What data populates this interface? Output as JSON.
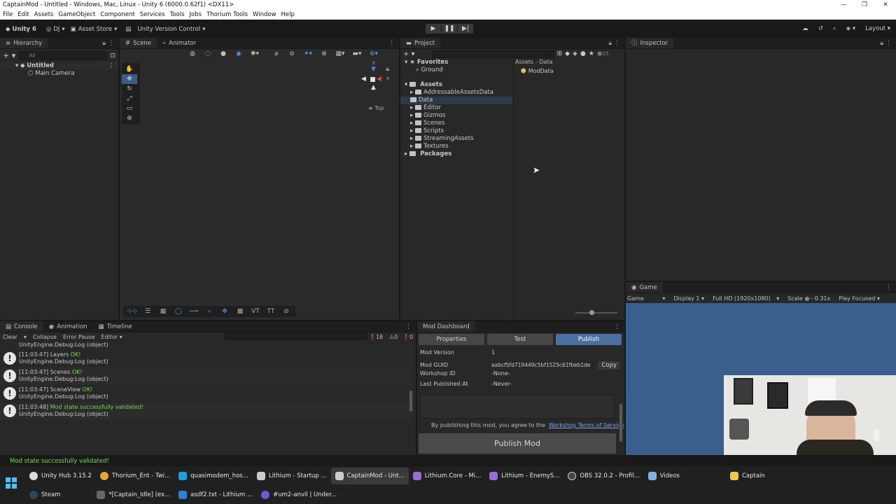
{
  "window": {
    "title": "CaptainMod - Untitled - Windows, Mac, Linux - Unity 6 (6000.0.62f1) <DX11>",
    "controls": [
      "—",
      "❐",
      "✕"
    ]
  },
  "menu": [
    "File",
    "Edit",
    "Assets",
    "GameObject",
    "Component",
    "Services",
    "Tools",
    "Jobs",
    "Thorium Tools",
    "Window",
    "Help"
  ],
  "toolbar": {
    "unity_label": "Unity 6",
    "account": "DJ",
    "asset_store": "Asset Store",
    "version_control": "Unity Version Control",
    "layout": "Layout"
  },
  "hierarchy": {
    "tab": "Hierarchy",
    "search_placeholder": "All",
    "scene": "Untitled",
    "items": [
      "Main Camera"
    ]
  },
  "scene_view": {
    "tabs": [
      "Scene",
      "Animator"
    ],
    "orientation": "Top",
    "gizmo_axes": {
      "y": "z",
      "x": "x"
    }
  },
  "project": {
    "tab": "Project",
    "count": "25",
    "favorites_label": "Favorites",
    "favorites": [
      "Ground"
    ],
    "assets_label": "Assets",
    "folders": [
      "AddressableAssetsData",
      "Data",
      "Editor",
      "Gizmos",
      "Scenes",
      "Scripts",
      "StreamingAssets",
      "Textures"
    ],
    "packages_label": "Packages",
    "breadcrumb": [
      "Assets",
      "Data"
    ],
    "breadcrumb_sep": "›",
    "contents": [
      "ModData"
    ]
  },
  "inspector": {
    "tab": "Inspector"
  },
  "game": {
    "tab": "Game",
    "mode": "Game",
    "display": "Display 1",
    "resolution": "Full HD (1920x1080)",
    "scale_label": "Scale",
    "scale_value": "0.31x",
    "play_mode": "Play Focused",
    "bg_color": "#3a5f8f"
  },
  "console": {
    "tabs": [
      "Console",
      "Animation",
      "Timeline"
    ],
    "buttons": [
      "Clear",
      "Collapse",
      "Error Pause",
      "Editor"
    ],
    "warn_count": "18",
    "error_count": "0",
    "partial_line": "UnityEngine.Debug:Log (object)",
    "logs": [
      {
        "time": "[11:03:47] Layers",
        "status": "OK!",
        "trace": "UnityEngine.Debug:Log (object)"
      },
      {
        "time": "[11:03:47] Scenes",
        "status": "OK!",
        "trace": "UnityEngine.Debug:Log (object)"
      },
      {
        "time": "[11:03:47] SceneView",
        "status": "OK!",
        "trace": "UnityEngine.Debug:Log (object)"
      },
      {
        "time": "[11:03:48]",
        "status": "Mod state successfully validated!",
        "trace": "UnityEngine.Debug:Log (object)"
      }
    ]
  },
  "mod_dashboard": {
    "tab": "Mod Dashboard",
    "tabs": [
      "Properties",
      "Test",
      "Publish"
    ],
    "fields": [
      {
        "label": "Mod Version",
        "value": "1"
      },
      {
        "label": "Mod GUID",
        "value": "aabcf5fd719449c5bf1525c61fbeb1de"
      },
      {
        "label": "Workshop ID",
        "value": "-None-"
      },
      {
        "label": "Last Published At",
        "value": "-Never-"
      }
    ],
    "copy_label": "Copy",
    "agree_text": "By publishing this mod, you agree to the",
    "terms_link": "Workshop Terms of Service",
    "publish_button": "Publish Mod"
  },
  "status_bar": "Mod state successfully validated!",
  "taskbar": {
    "row1": [
      {
        "label": "Unity Hub 3.15.2",
        "color": "#dddddd"
      },
      {
        "label": "Thorium_Ent - Twi...",
        "color": "#e8a33a"
      },
      {
        "label": "quasimodem_hos...",
        "color": "#1aa3d9"
      },
      {
        "label": "Lithium - Startup ...",
        "color": "#cccccc"
      },
      {
        "label": "CaptainMod - Unt...",
        "color": "#cccccc",
        "active": true
      },
      {
        "label": "Lithium.Core - Mi...",
        "color": "#9b6bd6"
      },
      {
        "label": "Lithium - EnemyS...",
        "color": "#9b6bd6"
      },
      {
        "label": "OBS 32.0.2 - Profil...",
        "color": "#444444"
      },
      {
        "label": "Videos",
        "color": "#7fb0e0"
      },
      {
        "label": "Captain",
        "color": "#f2c94c"
      }
    ],
    "row2": [
      {
        "label": "Steam",
        "color": "#2a475e"
      },
      {
        "label": "*[Captain_Idle] (ex...",
        "color": "#666666"
      },
      {
        "label": "asdf2.txt - Lithium ...",
        "color": "#2f7fd6"
      },
      {
        "label": "#um2-anvil | Under...",
        "color": "#6b5bd6"
      }
    ]
  }
}
